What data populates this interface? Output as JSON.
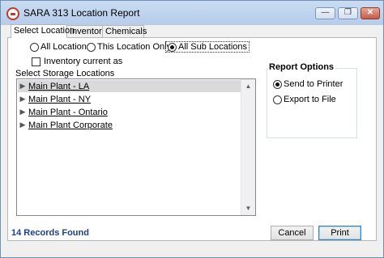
{
  "window": {
    "title": "SARA 313 Location Report",
    "minimize_glyph": "—",
    "restore_glyph": "❐",
    "close_glyph": "✕"
  },
  "tabs": [
    {
      "label": "Select Location",
      "active": true
    },
    {
      "label": "Inventory",
      "active": false
    },
    {
      "label": "Chemicals",
      "active": false
    }
  ],
  "scope": {
    "options": [
      {
        "label": "All Locations",
        "checked": false
      },
      {
        "label": "This Location Only",
        "checked": false
      },
      {
        "label": "All Sub Locations",
        "checked": true
      }
    ],
    "inventory_checkbox": {
      "label": "Inventory current as",
      "checked": false
    }
  },
  "storage": {
    "label": "Select Storage Locations",
    "items": [
      {
        "label": "Main Plant - LA",
        "selected": true
      },
      {
        "label": "Main Plant - NY",
        "selected": false
      },
      {
        "label": "Main Plant - Ontario",
        "selected": false
      },
      {
        "label": "Main Plant Corporate",
        "selected": false
      }
    ]
  },
  "report_options": {
    "title": "Report Options",
    "options": [
      {
        "label": "Send to Printer",
        "checked": true
      },
      {
        "label": "Export to File",
        "checked": false
      }
    ]
  },
  "footer": {
    "status": "14 Records Found",
    "cancel_label": "Cancel",
    "print_label": "Print"
  },
  "icons": {
    "expand": "chevron-right-icon",
    "scroll_up": "arrow-up-icon",
    "scroll_down": "arrow-down-icon"
  },
  "colors": {
    "status_text": "#1f3d8f",
    "title_bar": "#c9dcf3",
    "selected_row": "#dadada",
    "close_button": "#c55c46"
  }
}
